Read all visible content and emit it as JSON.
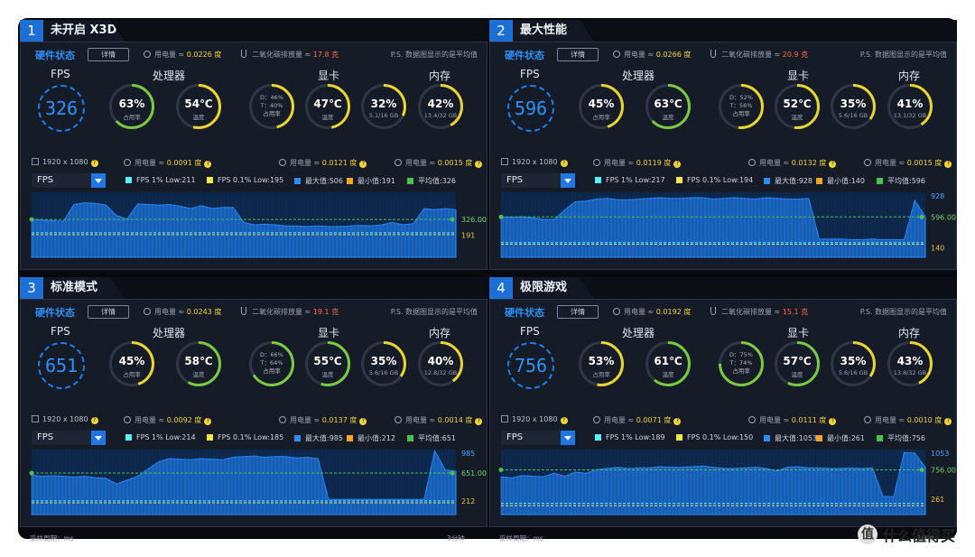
{
  "colors": {
    "accent": "#1e7ef0",
    "fps_1pct": "#5cf0ff",
    "fps_01pct": "#f5e64a",
    "max": "#2d8cff",
    "min": "#f5a623",
    "avg": "#4cc14c",
    "gauge_green": "#7ac943",
    "gauge_yellow": "#e8d531"
  },
  "common": {
    "section_title": "硬件状态",
    "detail_button": "详情",
    "power_label": "用电量 ≈",
    "co2_label": "二氧化碳排放量 ≈",
    "ps_note": "P.S. 数据图显示的是平均值",
    "fps_label": "FPS",
    "cpu_label": "处理器",
    "gpu_label": "显卡",
    "mem_label": "内存",
    "usage_label": "占用率",
    "temp_label": "温度",
    "resolution": "1920 x 1080",
    "sub_power_label": "用电量 ≈",
    "select_value": "FPS",
    "legend_1pct": "FPS 1% Low:",
    "legend_01pct": "FPS 0.1% Low:",
    "legend_max": "最大值:",
    "legend_min": "最小值:",
    "legend_avg": "平均值:",
    "sample_period": "采样周期：ms",
    "duration": "3分钟",
    "duration_alt": "2分钟",
    "question": "?"
  },
  "panels": [
    {
      "num": "1",
      "title": "未开启 X3D",
      "power": "0.0226 度",
      "co2": "17.8 克",
      "fps": "326",
      "cpu_usage": "63%",
      "cpu_usage_pct": 63,
      "cpu_temp": "54℃",
      "cpu_temp_val": 54,
      "gpu_d": "D：46%",
      "gpu_t": "T：40%",
      "gpu_d_val": 46,
      "gpu_temp": "47℃",
      "gpu_temp_val": 47,
      "vram": "32%",
      "vram_val": 32,
      "vram_sub": "5.1/16 GB",
      "mem": "42%",
      "mem_val": 42,
      "mem_sub": "13.4/32 GB",
      "cpu_power": "0.0091 度",
      "gpu_power": "0.0121 度",
      "mem_power": "0.0015 度",
      "low1": "211",
      "low01": "195",
      "max": "506",
      "min": "191",
      "avg": "326",
      "chart_max_label": "",
      "chart_avg_label": "326.00",
      "chart_min_label": "191",
      "foot_right": "3分钟"
    },
    {
      "num": "2",
      "title": "最大性能",
      "power": "0.0266 度",
      "co2": "20.9 克",
      "fps": "596",
      "cpu_usage": "45%",
      "cpu_usage_pct": 45,
      "cpu_temp": "63℃",
      "cpu_temp_val": 63,
      "gpu_d": "D：52%",
      "gpu_t": "T：56%",
      "gpu_d_val": 52,
      "gpu_temp": "52℃",
      "gpu_temp_val": 52,
      "vram": "35%",
      "vram_val": 35,
      "vram_sub": "5.6/16 GB",
      "mem": "41%",
      "mem_val": 41,
      "mem_sub": "13.1/32 GB",
      "cpu_power": "0.0119 度",
      "gpu_power": "0.0132 度",
      "mem_power": "0.0015 度",
      "low1": "217",
      "low01": "194",
      "max": "928",
      "min": "140",
      "avg": "596",
      "chart_max_label": "928",
      "chart_avg_label": "596.00",
      "chart_min_label": "140",
      "foot_right": "3分钟"
    },
    {
      "num": "3",
      "title": "标准模式",
      "power": "0.0243 度",
      "co2": "19.1 克",
      "fps": "651",
      "cpu_usage": "45%",
      "cpu_usage_pct": 45,
      "cpu_temp": "58℃",
      "cpu_temp_val": 58,
      "gpu_d": "D：66%",
      "gpu_t": "T：64%",
      "gpu_d_val": 66,
      "gpu_temp": "55℃",
      "gpu_temp_val": 55,
      "vram": "35%",
      "vram_val": 35,
      "vram_sub": "5.6/16 GB",
      "mem": "40%",
      "mem_val": 40,
      "mem_sub": "12.8/32 GB",
      "cpu_power": "0.0092 度",
      "gpu_power": "0.0137 度",
      "mem_power": "0.0014 度",
      "low1": "214",
      "low01": "185",
      "max": "985",
      "min": "212",
      "avg": "651",
      "chart_max_label": "985",
      "chart_avg_label": "651.00",
      "chart_min_label": "212",
      "foot_right": "3分钟"
    },
    {
      "num": "4",
      "title": "极限游戏",
      "power": "0.0192 度",
      "co2": "15.1 克",
      "fps": "756",
      "cpu_usage": "53%",
      "cpu_usage_pct": 53,
      "cpu_temp": "61℃",
      "cpu_temp_val": 61,
      "gpu_d": "D：75%",
      "gpu_t": "T：74%",
      "gpu_d_val": 75,
      "gpu_temp": "57℃",
      "gpu_temp_val": 57,
      "vram": "35%",
      "vram_val": 35,
      "vram_sub": "5.6/16 GB",
      "mem": "43%",
      "mem_val": 43,
      "mem_sub": "13.8/32 GB",
      "cpu_power": "0.0071 度",
      "gpu_power": "0.0111 度",
      "mem_power": "0.0010 度",
      "low1": "189",
      "low01": "150",
      "max": "1053",
      "min": "261",
      "avg": "756",
      "chart_max_label": "1053",
      "chart_avg_label": "756.00",
      "chart_min_label": "261",
      "foot_right": "2分钟"
    }
  ],
  "chart_data": [
    {
      "type": "area",
      "ylim": [
        0,
        560
      ],
      "series": [
        {
          "values": [
            330,
            320,
            315,
            310,
            455,
            470,
            465,
            450,
            360,
            330,
            460,
            455,
            450,
            455,
            440,
            420,
            445,
            420,
            430,
            430,
            300,
            280,
            285,
            280,
            270,
            270,
            265,
            270,
            265,
            265,
            270,
            275,
            270,
            280,
            300,
            280,
            290,
            420,
            410,
            420,
            410
          ]
        }
      ]
    },
    {
      "type": "area",
      "ylim": [
        0,
        960
      ],
      "series": [
        {
          "values": [
            600,
            590,
            600,
            580,
            560,
            560,
            700,
            820,
            830,
            860,
            870,
            850,
            850,
            860,
            870,
            880,
            870,
            870,
            880,
            880,
            860,
            870,
            880,
            870,
            860,
            880,
            870,
            860,
            860,
            870,
            270,
            270,
            270,
            260,
            260,
            270,
            260,
            260,
            260,
            840,
            600
          ]
        }
      ]
    },
    {
      "type": "area",
      "ylim": [
        0,
        1020
      ],
      "series": [
        {
          "values": [
            620,
            600,
            610,
            600,
            590,
            600,
            580,
            570,
            480,
            540,
            600,
            720,
            830,
            880,
            870,
            860,
            880,
            870,
            860,
            900,
            910,
            920,
            900,
            910,
            910,
            890,
            900,
            880,
            240,
            240,
            240,
            240,
            240,
            240,
            240,
            240,
            240,
            240,
            1000,
            700,
            680
          ]
        }
      ]
    },
    {
      "type": "area",
      "ylim": [
        0,
        1100
      ],
      "series": [
        {
          "values": [
            640,
            620,
            660,
            650,
            640,
            700,
            650,
            720,
            700,
            760,
            780,
            800,
            780,
            790,
            790,
            810,
            800,
            800,
            810,
            820,
            800,
            780,
            780,
            790,
            800,
            780,
            740,
            800,
            810,
            790,
            790,
            780,
            780,
            790,
            780,
            790,
            310,
            300,
            1050,
            1040,
            800
          ]
        }
      ]
    }
  ]
}
